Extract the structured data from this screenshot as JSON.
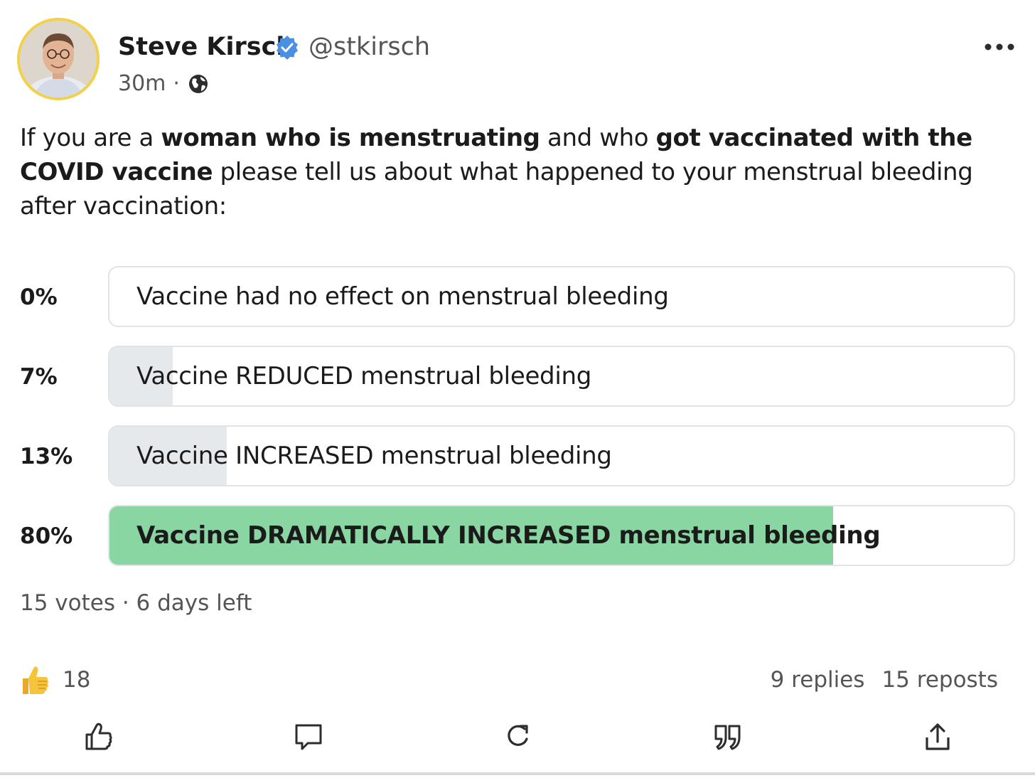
{
  "author": {
    "name": "Steve Kirsch",
    "handle": "@stkirsch",
    "time": "30m",
    "separator": "·"
  },
  "post": {
    "segments": [
      {
        "text": "If you are a ",
        "bold": false
      },
      {
        "text": "woman who is menstruating",
        "bold": true
      },
      {
        "text": " and who ",
        "bold": false
      },
      {
        "text": "got vaccinated with the COVID vaccine",
        "bold": true
      },
      {
        "text": " please tell us about what happened to your menstrual bleeding after vaccination:",
        "bold": false
      }
    ]
  },
  "poll": {
    "options": [
      {
        "percent_label": "0%",
        "percent": 0,
        "label": "Vaccine had no effect on menstrual bleeding",
        "winner": false
      },
      {
        "percent_label": "7%",
        "percent": 7,
        "label": "Vaccine REDUCED menstrual bleeding",
        "winner": false
      },
      {
        "percent_label": "13%",
        "percent": 13,
        "label": "Vaccine INCREASED menstrual bleeding",
        "winner": false
      },
      {
        "percent_label": "80%",
        "percent": 80,
        "label": "Vaccine DRAMATICALLY INCREASED menstrual bleeding",
        "winner": true
      }
    ],
    "summary": "15 votes · 6 days left"
  },
  "engagement": {
    "likes": "18",
    "replies": "9 replies",
    "reposts": "15 reposts"
  },
  "colors": {
    "avatar_ring": "#f2d04a",
    "verified": "#4a90e2",
    "winner_fill": "#8ad6a2",
    "option_fill": "#e6e9ec"
  },
  "icons": {
    "verified": "verified-badge-icon",
    "globe": "globe-icon",
    "more": "more-horizontal-icon",
    "like_emoji": "thumbs-up-emoji-icon",
    "like": "thumbs-up-outline-icon",
    "reply": "comment-icon",
    "repost": "repost-icon",
    "quote": "quote-icon",
    "share": "share-icon"
  }
}
